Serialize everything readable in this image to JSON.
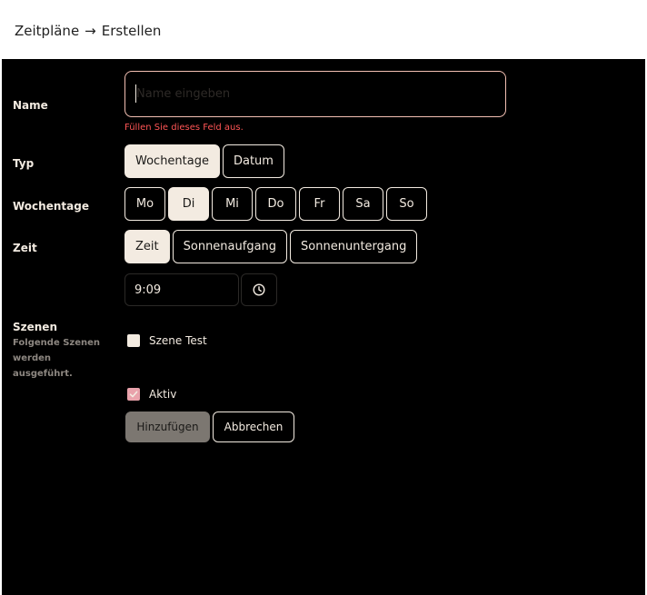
{
  "breadcrumb": {
    "parent": "Zeitpläne",
    "separator": "→",
    "current": "Erstellen"
  },
  "form": {
    "name": {
      "label": "Name",
      "value": "",
      "placeholder": "Name eingeben",
      "error": "Füllen Sie dieses Feld aus."
    },
    "type": {
      "label": "Typ",
      "options": [
        "Wochentage",
        "Datum"
      ],
      "selected": "Wochentage"
    },
    "weekdays": {
      "label": "Wochentage",
      "options": [
        "Mo",
        "Di",
        "Mi",
        "Do",
        "Fr",
        "Sa",
        "So"
      ],
      "selected": [
        "Di"
      ]
    },
    "time": {
      "label": "Zeit",
      "options": [
        "Zeit",
        "Sonnenaufgang",
        "Sonnenuntergang"
      ],
      "selected": "Zeit",
      "value": "9:09",
      "picker_icon": "clock-icon"
    },
    "scenes": {
      "label": "Szenen",
      "description": "Folgende Szenen werden ausgeführt.",
      "items": [
        {
          "label": "Szene Test",
          "checked": false
        }
      ]
    },
    "active": {
      "label": "Aktiv",
      "checked": true
    },
    "submit_label": "Hinzufügen",
    "cancel_label": "Abbrechen"
  },
  "colors": {
    "background": "#000000",
    "foreground": "#f3ebe1",
    "input_border": "#f3c0b3",
    "error": "#ff5555",
    "checkbox_checked": "#e9a2ab",
    "submit_bg": "#7c7771"
  }
}
